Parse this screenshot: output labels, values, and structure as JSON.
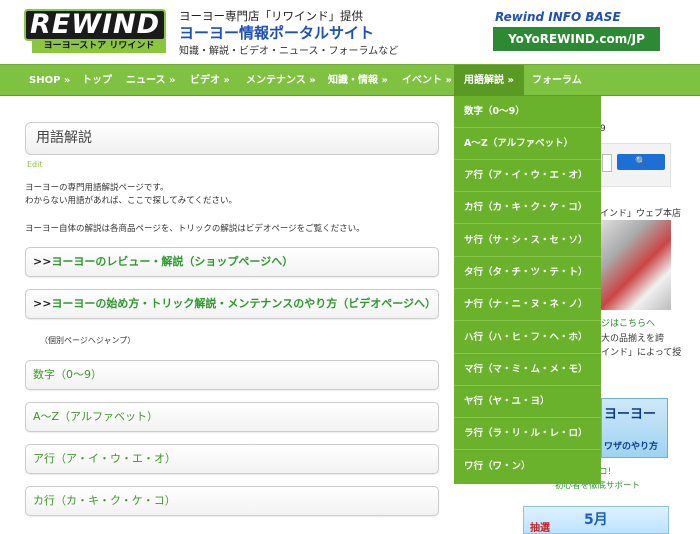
{
  "header": {
    "logo_main": "REWIND",
    "logo_sub": "ヨーヨーストア リワインド",
    "tagline": "ヨーヨー専門店「リワインド」提供",
    "site_title": "ヨーヨー情報ポータルサイト",
    "site_desc": "知識・解説・ビデオ・ニュース・フォーラムなど",
    "info_label": "Rewind INFO BASE",
    "info_url": "YoYoREWIND.com/JP"
  },
  "nav": {
    "items": [
      {
        "label": "SHOP »"
      },
      {
        "label": "トップ"
      },
      {
        "label": "ニュース »"
      },
      {
        "label": "ビデオ »"
      },
      {
        "label": "メンテナンス »"
      },
      {
        "label": "知識・情報 »"
      },
      {
        "label": "イベント »"
      },
      {
        "label": "用語解説 »"
      },
      {
        "label": "フォーラム"
      }
    ]
  },
  "dropdown": {
    "items": [
      {
        "label": "数字（0〜9）"
      },
      {
        "label": "A〜Z（アルファベット）"
      },
      {
        "label": "ア行（ア・イ・ウ・エ・オ）"
      },
      {
        "label": "カ行（カ・キ・ク・ケ・コ）"
      },
      {
        "label": "サ行（サ・シ・ス・セ・ソ）"
      },
      {
        "label": "タ行（タ・チ・ツ・テ・ト）"
      },
      {
        "label": "ナ行（ナ・ニ・ヌ・ネ・ノ）"
      },
      {
        "label": "ハ行（ハ・ヒ・フ・ヘ・ホ）"
      },
      {
        "label": "マ行（マ・ミ・ム・メ・モ）"
      },
      {
        "label": "ヤ行（ヤ・ユ・ヨ）"
      },
      {
        "label": "ラ行（ラ・リ・ル・レ・ロ）"
      },
      {
        "label": "ワ行（ワ・ン）"
      }
    ]
  },
  "main": {
    "heading": "用語解説",
    "edit": "Edit",
    "intro1": "ヨーヨーの専門用語解説ページです。",
    "intro2": "わからない用語があれば、ここで探してみてください。",
    "intro3": "ヨーヨー自体の解説は各商品ページを、トリックの解説はビデオページをご覧ください。",
    "link_boxes": [
      {
        "arrow": ">>",
        "text": "ヨーヨーのレビュー・解説（ショップページへ）"
      },
      {
        "arrow": ">>",
        "text": "ヨーヨーの始め方・トリック解説・メンテナンスのやり方（ビデオページへ）"
      }
    ],
    "jump_note": "（個別ページへジャンプ）",
    "category_boxes": [
      {
        "label": "数字（0〜9）"
      },
      {
        "label": "A〜Z（アルファベット）"
      },
      {
        "label": "ア行（ア・イ・ウ・エ・オ）"
      },
      {
        "label": "カ行（カ・キ・ク・ケ・コ）"
      }
    ]
  },
  "sidebar": {
    "label": "9",
    "search_button": "🔍",
    "shop_title": "インド」ウェブ本店",
    "shop_link": "ジはこちらへ",
    "shop_text1": "大の品揃えを誇",
    "shop_text2": "インド」によって授",
    "banner1_title": "ヨーヨー",
    "banner1_sub": "ワザのやり方",
    "caption1": "じめるならココ！",
    "caption2": "初心者を徹底サポート",
    "banner2_a": "抽選",
    "banner2_b": "5月"
  }
}
